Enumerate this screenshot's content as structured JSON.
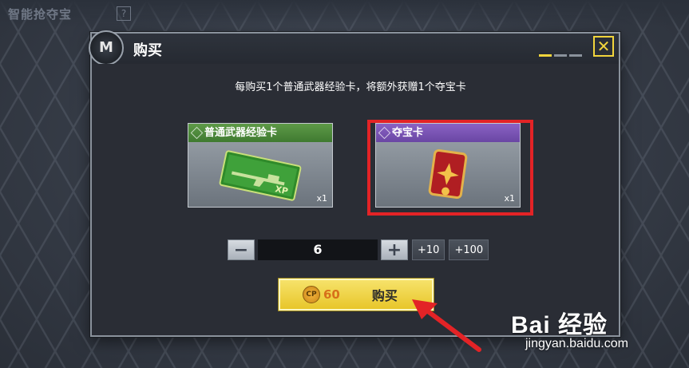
{
  "background": {
    "title": "智能抢夺宝",
    "help_glyph": "?"
  },
  "dialog": {
    "logo_glyph": "M",
    "title": "购买",
    "close_glyph": "✕",
    "promo_text": "每购买1个普通武器经验卡，将额外获赠1个夺宝卡",
    "items": [
      {
        "name": "普通武器经验卡",
        "qty": "x1",
        "color": "#4e8c3c"
      },
      {
        "name": "夺宝卡",
        "qty": "x1",
        "color": "#7a55b6"
      }
    ],
    "quantity": {
      "minus": "−",
      "value": "6",
      "plus": "+",
      "add10": "+10",
      "add100": "+100"
    },
    "buy": {
      "currency_icon": "CP",
      "price": "60",
      "label": "购买"
    }
  },
  "watermark": {
    "brand": "Bai 经验",
    "url": "jingyan.baidu.com"
  },
  "colors": {
    "accent_yellow": "#f2d53c",
    "highlight_red": "#e32326",
    "price_orange": "#d7701a"
  }
}
